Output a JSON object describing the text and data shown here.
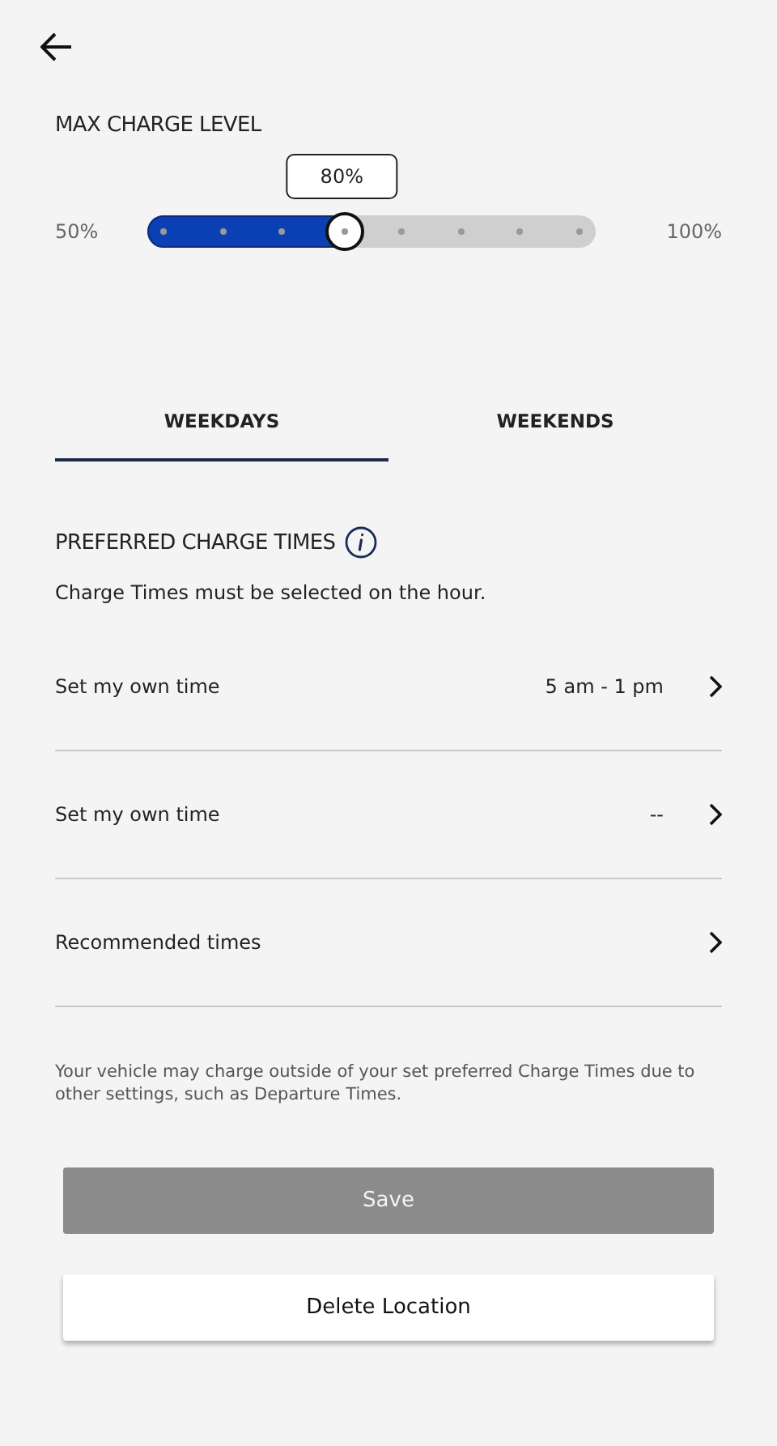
{
  "charge_level": {
    "title": "MAX CHARGE LEVEL",
    "min_label": "50%",
    "max_label": "100%",
    "tooltip": "80%",
    "level": 0.4286
  },
  "tabs": [
    {
      "label": "WEEKDAYS",
      "selected": true
    },
    {
      "label": "WEEKENDS",
      "selected": false
    }
  ],
  "preferred": {
    "title": "PREFERRED CHARGE TIMES",
    "subtitle": "Charge Times must be selected on the hour."
  },
  "rows": [
    {
      "label": "Set my own time",
      "value": "5 am - 1 pm"
    },
    {
      "label": "Set my own time",
      "value": "--"
    },
    {
      "label": "Recommended times"
    }
  ],
  "note": "Your vehicle may charge outside of your set preferred Charge Times due to other settings, such as Departure Times.",
  "buttons": [
    {
      "label": "Save",
      "kind": "primary",
      "disabled": true
    },
    {
      "label": "Delete Location",
      "kind": "secondary",
      "disabled": false
    }
  ]
}
